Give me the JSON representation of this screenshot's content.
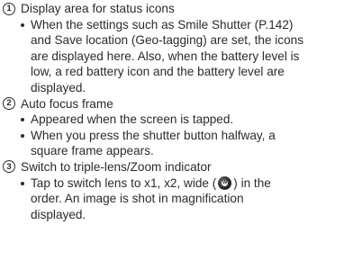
{
  "items": [
    {
      "number": "1",
      "title": "Display area for status icons",
      "bullets": [
        {
          "lines": [
            "When the settings such as Smile Shutter (P.142)",
            "and Save location (Geo-tagging) are set, the icons",
            "are displayed here. Also, when the battery level is",
            "low, a red battery icon and the battery level are",
            "displayed."
          ]
        }
      ]
    },
    {
      "number": "2",
      "title": "Auto focus frame",
      "bullets": [
        {
          "lines": [
            "Appeared when the screen is tapped."
          ]
        },
        {
          "lines": [
            "When you press the shutter button halfway, a",
            "square frame appears."
          ]
        }
      ]
    },
    {
      "number": "3",
      "title": "Switch to triple-lens/Zoom indicator",
      "bullets": [
        {
          "line1_before_icon": "Tap to switch lens to x1, x2, wide (",
          "line1_after_icon": ") in the",
          "lines": [
            "order. An image is shot in magnification",
            "displayed."
          ]
        }
      ]
    }
  ],
  "icons": {
    "wide_lens_icon": "wide-lens-icon"
  }
}
